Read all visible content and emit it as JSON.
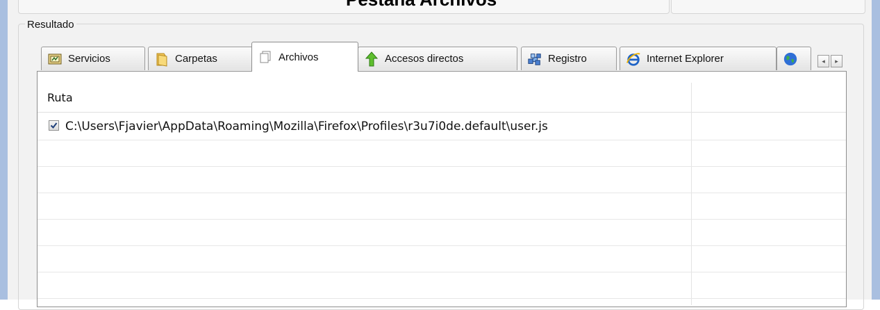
{
  "window": {
    "overlay_title": "Pestaña Archivos"
  },
  "group": {
    "legend": "Resultado"
  },
  "tabs": [
    {
      "label": "Servicios",
      "icon": "services-icon"
    },
    {
      "label": "Carpetas",
      "icon": "folder-icon"
    },
    {
      "label": "Archivos",
      "icon": "files-icon",
      "active": true
    },
    {
      "label": "Accesos directos",
      "icon": "shortcut-arrow-icon"
    },
    {
      "label": "Registro",
      "icon": "registry-icon"
    },
    {
      "label": "Internet Explorer",
      "icon": "ie-icon"
    },
    {
      "label": "",
      "icon": "globe-icon"
    }
  ],
  "tab_scroll": {
    "left": "◂",
    "right": "▸"
  },
  "table": {
    "columns": [
      "Ruta"
    ],
    "rows": [
      {
        "checked": true,
        "path": "C:\\Users\\Fjavier\\AppData\\Roaming\\Mozilla\\Firefox\\Profiles\\r3u7i0de.default\\user.js"
      }
    ]
  },
  "colors": {
    "frame": "#a9bfe0",
    "panel": "#f2f2f2",
    "accent_blue": "#1e63c6"
  }
}
